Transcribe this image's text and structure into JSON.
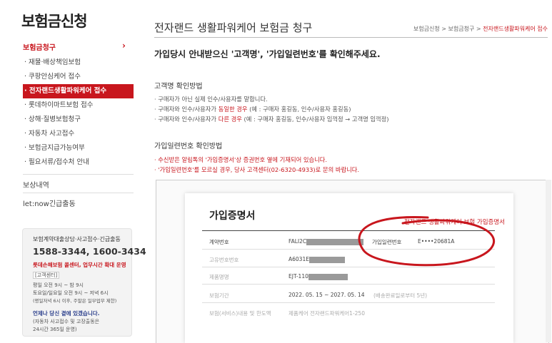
{
  "sidebar": {
    "title": "보험금신청",
    "section": "보험금청구",
    "chevron_icon": "chevron-right-icon",
    "items": [
      {
        "label": "· 재물·배상책임보험"
      },
      {
        "label": "· 쿠팡안심케어 접수"
      },
      {
        "label": "· 전자랜드생활파워케어 접수",
        "active": true
      },
      {
        "label": "· 롯데하이마트보험 접수"
      },
      {
        "label": "· 상해·질병보험청구"
      },
      {
        "label": "· 자동차 사고접수"
      },
      {
        "label": "· 보험금지급가능여부"
      },
      {
        "label": "· 필요서류/접수처 안내"
      }
    ],
    "extra": [
      "보상내역",
      "let:now긴급출동"
    ],
    "contact": {
      "title": "보험계약대출상담·사고접수·긴급출동",
      "phone": "1588-3344,  1600-3434",
      "lotte": "롯데손해보험 콜센터, 업무시간 확대 운영",
      "tag": "[고객센터]",
      "hours1": "평일  오전 9시 ~ 밤 9시",
      "hours2": "토요일/일요일  오전 9시 ~ 저녁 6시",
      "hours3": "(평일저녁 6시 이후, 주말은 일부업무 제한)",
      "anytime": "언제나 당신 곁에 있겠습니다.",
      "anytime2": "(자동차 사고접수 및 고장출동은",
      "anytime3": "24시간 365일 운영)"
    }
  },
  "header": {
    "title": "전자랜드 생활파워케어 보험금 청구",
    "breadcrumb": [
      "보험금신청",
      "보험금청구",
      "전자랜드생활파워케어 접수"
    ],
    "sep": ">"
  },
  "content": {
    "intro": "가입당시 안내받으신 '고객명', '가입일련번호'를 확인해주세요.",
    "customer_heading": "고객명 확인방법",
    "customer_lines": [
      {
        "pre": "· 구매자가 아닌 실제 인수/사용자를 말합니다.",
        "red": "",
        "post": ""
      },
      {
        "pre": "· 구매자와 인수/사용자가 ",
        "red": "동일한 경우",
        "post": " (예 : 구매자 홍길동, 인수/사용자 홍길동)"
      },
      {
        "pre": "· 구매자와 인수/사용자가 ",
        "red": "다른 경우",
        "post": " (예 : 구매자 홍길동, 인수/사용자 임꺽정 → 고객명 임꺽정)"
      }
    ],
    "serial_heading": "가입일련번호 확인방법",
    "serial_lines": [
      "· 수신받은 알림톡의 '가입증명서'상 증권번호 옆에 기재되어 있습니다.",
      "· '가입일련번호'를 모르실 경우, 당사 고객센터(02-6320-4933)로 문의 바랍니다."
    ]
  },
  "certificate": {
    "title": "가입증명서",
    "subtitle": "전자랜드 생활파워케어 보험 가입증명서",
    "contract_label": "계약번호",
    "contract_value": "FALI2C",
    "serial_label": "가입일련번호",
    "serial_value": "E••••20681A",
    "row2_label": "고유번호번호",
    "row2_value": "A6031E",
    "row3_label": "제품명명",
    "row3_value": "EJT-110",
    "period_label": "보험기간",
    "period_value": "2022. 05. 15 ~ 2027. 05. 14",
    "period_note": "(배송완료일로부터   5년)",
    "row5_label": "보험(서비스)내용 및 한도액",
    "row5_value": "제품케어   전자랜드파워케어1-250",
    "highlight_color": "#c8161d"
  }
}
